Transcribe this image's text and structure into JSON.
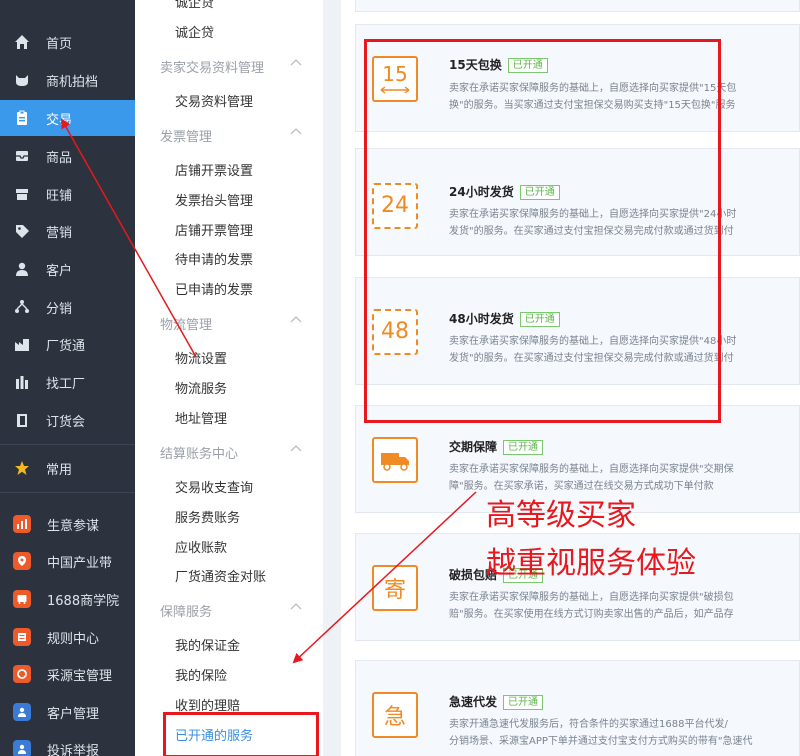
{
  "nav": {
    "items": [
      {
        "label": "首页",
        "icon": "home-icon"
      },
      {
        "label": "商机拍档",
        "icon": "cat-icon"
      },
      {
        "label": "交易",
        "icon": "clipboard-icon",
        "active": true
      },
      {
        "label": "商品",
        "icon": "inbox-icon"
      },
      {
        "label": "旺铺",
        "icon": "store-icon"
      },
      {
        "label": "营销",
        "icon": "tag-icon"
      },
      {
        "label": "客户",
        "icon": "user-icon"
      },
      {
        "label": "分销",
        "icon": "share-icon"
      },
      {
        "label": "厂货通",
        "icon": "factory-icon"
      },
      {
        "label": "找工厂",
        "icon": "building-icon"
      },
      {
        "label": "订货会",
        "icon": "door-icon"
      }
    ],
    "common": {
      "label": "常用",
      "icon": "star-icon"
    },
    "apps": [
      {
        "label": "生意参谋",
        "icon": "chart-icon"
      },
      {
        "label": "中国产业带",
        "icon": "map-pin-icon"
      },
      {
        "label": "1688商学院",
        "icon": "bus-icon"
      },
      {
        "label": "规则中心",
        "icon": "rules-icon"
      },
      {
        "label": "采源宝管理",
        "icon": "source-icon"
      },
      {
        "label": "客户管理",
        "icon": "customer-icon"
      },
      {
        "label": "投诉举报",
        "icon": "report-icon"
      }
    ]
  },
  "submenu": {
    "top_items": [
      "诚企贷"
    ],
    "groups": [
      {
        "title": "卖家交易资料管理",
        "items": [
          "交易资料管理"
        ]
      },
      {
        "title": "发票管理",
        "items": [
          "店铺开票设置",
          "发票抬头管理",
          "店铺开票管理",
          "待申请的发票",
          "已申请的发票"
        ]
      },
      {
        "title": "物流管理",
        "items": [
          "物流设置",
          "物流服务",
          "地址管理"
        ]
      },
      {
        "title": "结算账务中心",
        "items": [
          "交易收支查询",
          "服务费账务",
          "应收账款",
          "厂货通资金对账"
        ]
      },
      {
        "title": "保障服务",
        "items": [
          "我的保证金",
          "我的保险",
          "收到的理赔",
          "已开通的服务"
        ]
      }
    ]
  },
  "services": [
    {
      "icon_text": "15",
      "icon": "15-day-exchange-icon",
      "title": "15天包换",
      "badge": "已开通",
      "desc": [
        "卖家在承诺买家保障服务的基础上，自愿选择向买家提供\"15天包",
        "换\"的服务。当买家通过支付宝担保交易购买支持\"15天包换\"服务"
      ]
    },
    {
      "icon_text": "24",
      "icon": "24-hour-shipping-icon",
      "title": "24小时发货",
      "badge": "已开通",
      "desc": [
        "卖家在承诺买家保障服务的基础上，自愿选择向买家提供\"24小时",
        "发货\"的服务。在买家通过支付宝担保交易完成付款或通过货到付"
      ]
    },
    {
      "icon_text": "48",
      "icon": "48-hour-shipping-icon",
      "title": "48小时发货",
      "badge": "已开通",
      "desc": [
        "卖家在承诺买家保障服务的基础上，自愿选择向买家提供\"48小时",
        "发货\"的服务。在买家通过支付宝担保交易完成付款或通过货到付"
      ]
    },
    {
      "icon_text": "",
      "icon": "truck-icon",
      "title": "交期保障",
      "badge": "已开通",
      "desc": [
        "卖家在承诺买家保障服务的基础上，自愿选择向买家提供\"交期保",
        "障\"服务。在买家承诺，买家通过在线交易方式成功下单付款"
      ]
    },
    {
      "icon_text": "寄",
      "icon": "send-icon",
      "title": "破损包赔",
      "badge": "已开通",
      "desc": [
        "卖家在承诺买家保障服务的基础上，自愿选择向买家提供\"破损包",
        "赔\"服务。在买家使用在线方式订购卖家出售的产品后，如产品存"
      ]
    },
    {
      "icon_text": "急",
      "icon": "urgent-icon",
      "title": "急速代发",
      "badge": "已开通",
      "desc": [
        "卖家开通急速代发服务后，符合条件的买家通过1688平台代发/",
        "分销场景、采源宝APP下单并通过支付宝支付方式购买的带有\"急速代"
      ]
    }
  ],
  "annotation": {
    "line1": "高等级买家",
    "line2": "越重视服务体验",
    "color": "#e8191e"
  },
  "colors": {
    "nav_bg": "#2c323e",
    "nav_active": "#3a99ea",
    "accent_orange": "#f08a24",
    "badge_green": "#5cb54a",
    "selected_link": "#3a8ee6"
  }
}
